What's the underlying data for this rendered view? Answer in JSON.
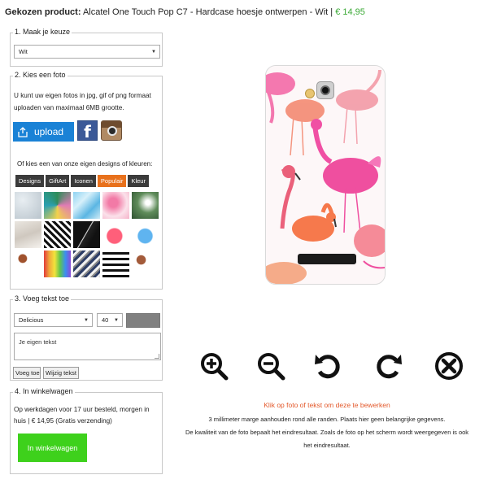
{
  "header": {
    "label": "Gekozen product:",
    "product": "Alcatel One Touch Pop C7 - Hardcase hoesje ontwerpen - Wit",
    "separator": "|",
    "price": "€ 14,95"
  },
  "step1": {
    "legend": "1. Maak je keuze",
    "select_value": "Wit"
  },
  "step2": {
    "legend": "2. Kies een foto",
    "text": "U kunt uw eigen fotos in jpg, gif of png formaat uploaden van maximaal 6MB grootte.",
    "upload_label": "upload",
    "designs_label": "Of kies een van onze eigen designs of kleuren:",
    "tabs": [
      "Designs",
      "GiftArt",
      "Iconen",
      "Populair",
      "Kleur"
    ],
    "active_tab": "Populair"
  },
  "step3": {
    "legend": "3. Voeg tekst toe",
    "font_value": "Delicious",
    "size_value": "40",
    "textarea_value": "Je eigen tekst",
    "add_button": "Voeg toe",
    "edit_button": "Wijzig tekst"
  },
  "step4": {
    "legend": "4. In winkelwagen",
    "text": "Op werkdagen voor 17 uur besteld, morgen in huis | € 14,95 (Gratis verzending)",
    "cart_button": "In winkelwagen"
  },
  "info": {
    "instruction": "Klik op foto of tekst om deze te bewerken",
    "line2": "3 millimeter marge aanhouden rond alle randen. Plaats hier geen belangrijke gegevens.",
    "line3": "De kwaliteit van de foto bepaalt het eindresultaat. Zoals de foto op het scherm wordt weergegeven is ook",
    "line4": "het eindresultaat."
  },
  "tools": [
    "zoom-in-icon",
    "zoom-out-icon",
    "rotate-left-icon",
    "rotate-right-icon",
    "delete-icon"
  ],
  "colors": {
    "price": "#3aa935",
    "upload": "#1a82d6",
    "active_tab": "#e8711c",
    "cart": "#3ed11c",
    "instruction": "#e3582a"
  }
}
